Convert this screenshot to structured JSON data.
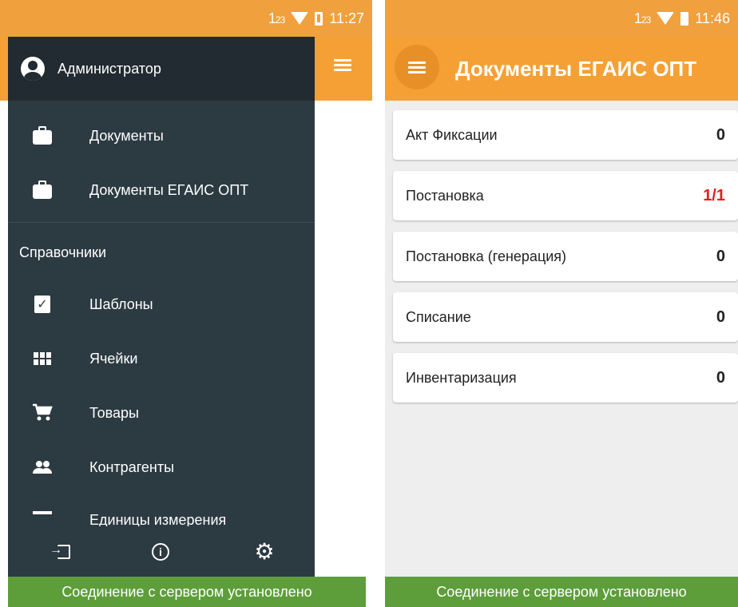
{
  "left": {
    "status": {
      "num_big": "1",
      "num_small": "23",
      "time": "11:27"
    },
    "drawer": {
      "username": "Администратор",
      "items_top": [
        {
          "label": "Документы",
          "icon": "briefcase-icon"
        },
        {
          "label": "Документы ЕГАИС ОПТ",
          "icon": "briefcase-icon"
        }
      ],
      "section_title": "Справочники",
      "items_ref": [
        {
          "label": "Шаблоны",
          "icon": "clipboard-check-icon"
        },
        {
          "label": "Ячейки",
          "icon": "grid-icon"
        },
        {
          "label": "Товары",
          "icon": "cart-icon"
        },
        {
          "label": "Контрагенты",
          "icon": "people-icon"
        },
        {
          "label": "Единицы измерения",
          "icon": "ruler-icon"
        }
      ],
      "footer_icons": [
        "exit-icon",
        "info-icon",
        "gear-icon"
      ]
    },
    "bottom_status": "Соединение с сервером установлено"
  },
  "right": {
    "status": {
      "num_big": "1",
      "num_small": "23",
      "time": "11:46"
    },
    "title": "Документы ЕГАИС ОПТ",
    "cards": [
      {
        "label": "Акт Фиксации",
        "value": "0",
        "color": "#222222"
      },
      {
        "label": "Постановка",
        "value": "1/1",
        "color": "#e0201c"
      },
      {
        "label": "Постановка (генерация)",
        "value": "0",
        "color": "#222222"
      },
      {
        "label": "Списание",
        "value": "0",
        "color": "#222222"
      },
      {
        "label": "Инвентаризация",
        "value": "0",
        "color": "#222222"
      }
    ],
    "bottom_status": "Соединение с сервером установлено"
  },
  "colors": {
    "accent": "#f4a035",
    "drawer_bg": "#2c3a42",
    "drawer_head": "#212b31",
    "success": "#5d9e3a"
  }
}
